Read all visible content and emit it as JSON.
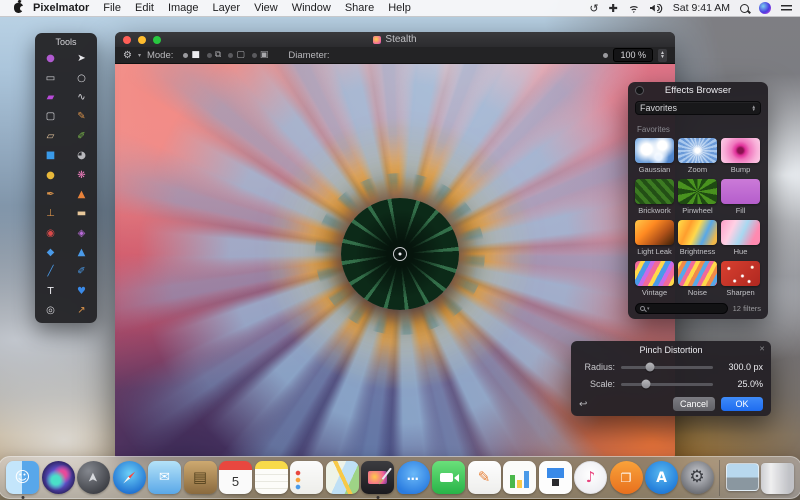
{
  "menu_bar": {
    "app_name": "Pixelmator",
    "items": [
      "File",
      "Edit",
      "Image",
      "Layer",
      "View",
      "Window",
      "Share",
      "Help"
    ],
    "status_icons": [
      "time-machine",
      "four-arrows",
      "wifi",
      "volume"
    ],
    "clock": "Sat 9:41 AM",
    "right_icons": [
      "spotlight",
      "siri",
      "notification-center"
    ],
    "time_machine_glyph": "↺",
    "four_arrows_glyph": "✚"
  },
  "tools_panel": {
    "title": "Tools",
    "tools": [
      {
        "name": "move",
        "glyph": "●",
        "color": "#b05ad0"
      },
      {
        "name": "arrange",
        "glyph": "➤",
        "color": "#e8e8ec"
      },
      {
        "name": "rectangular-selection",
        "glyph": "▭",
        "color": "#d8d8dc"
      },
      {
        "name": "elliptical-selection",
        "glyph": "○",
        "color": "#d8d8dc"
      },
      {
        "name": "magic-wand",
        "glyph": "▰",
        "color": "#b84ad8"
      },
      {
        "name": "lasso",
        "glyph": "∿",
        "color": "#d8d8dc"
      },
      {
        "name": "crop",
        "glyph": "▢",
        "color": "#d8d8dc"
      },
      {
        "name": "paint-brush",
        "glyph": "✎",
        "color": "#d8924a"
      },
      {
        "name": "eraser",
        "glyph": "▱",
        "color": "#e8c8a0"
      },
      {
        "name": "pencil",
        "glyph": "✐",
        "color": "#7ab84a"
      },
      {
        "name": "gradient",
        "glyph": "■",
        "color": "#3a9ae8"
      },
      {
        "name": "sponge",
        "glyph": "◕",
        "color": "#b8b8bc"
      },
      {
        "name": "dodge",
        "glyph": "●",
        "color": "#e8b83a"
      },
      {
        "name": "swatches",
        "glyph": "❋",
        "color": "#e87ab8"
      },
      {
        "name": "pen",
        "glyph": "✒",
        "color": "#d8924a"
      },
      {
        "name": "smudge",
        "glyph": "▲",
        "color": "#e8823a"
      },
      {
        "name": "clone-stamp",
        "glyph": "⊥",
        "color": "#d8924a"
      },
      {
        "name": "healing",
        "glyph": "▬",
        "color": "#e8c89a"
      },
      {
        "name": "red-eye",
        "glyph": "◉",
        "color": "#d84a4a"
      },
      {
        "name": "saturate",
        "glyph": "◈",
        "color": "#b86ad8"
      },
      {
        "name": "blur",
        "glyph": "◆",
        "color": "#4a9ae8"
      },
      {
        "name": "sharpen",
        "glyph": "▲",
        "color": "#4a9ae8"
      },
      {
        "name": "line",
        "glyph": "╱",
        "color": "#4a9ae8"
      },
      {
        "name": "draw-pencil",
        "glyph": "✐",
        "color": "#4a9ae8"
      },
      {
        "name": "type",
        "glyph": "T",
        "color": "#e8e8ec"
      },
      {
        "name": "shape",
        "glyph": "♥",
        "color": "#3a8ae8"
      },
      {
        "name": "zoom",
        "glyph": "◎",
        "color": "#d8d8dc"
      },
      {
        "name": "eyedropper",
        "glyph": "↗",
        "color": "#d8924a"
      }
    ]
  },
  "document_window": {
    "title": "Stealth",
    "toolbar": {
      "gear_glyph": "⚙",
      "mode_label": "Mode:",
      "modes": [
        {
          "name": "paint",
          "glyph": "■",
          "selected": true
        },
        {
          "name": "behind",
          "glyph": "⧉",
          "selected": false
        },
        {
          "name": "erase",
          "glyph": "▢",
          "selected": false
        },
        {
          "name": "refine",
          "glyph": "▣",
          "selected": false
        }
      ],
      "diameter_label": "Diameter:",
      "zoom_value": "100 %"
    }
  },
  "effects_browser": {
    "title": "Effects Browser",
    "category": "Favorites",
    "section_label": "Favorites",
    "filters": [
      {
        "key": "gaussian",
        "label": "Gaussian"
      },
      {
        "key": "zoom",
        "label": "Zoom"
      },
      {
        "key": "bump",
        "label": "Bump"
      },
      {
        "key": "brickwork",
        "label": "Brickwork"
      },
      {
        "key": "pinwheel",
        "label": "Pinwheel"
      },
      {
        "key": "fill",
        "label": "Fill"
      },
      {
        "key": "lightleak",
        "label": "Light Leak"
      },
      {
        "key": "brightness",
        "label": "Brightness"
      },
      {
        "key": "hue",
        "label": "Hue"
      },
      {
        "key": "vintage",
        "label": "Vintage"
      },
      {
        "key": "noise",
        "label": "Noise"
      },
      {
        "key": "sharpen",
        "label": "Sharpen"
      }
    ],
    "footer": "12 filters"
  },
  "pinch_panel": {
    "title": "Pinch Distortion",
    "radius_label": "Radius:",
    "radius_value": "300.0 px",
    "radius_pct": 31,
    "scale_label": "Scale:",
    "scale_value": "25.0%",
    "scale_pct": 27,
    "undo_glyph": "↩",
    "close_glyph": "✕",
    "cancel_label": "Cancel",
    "ok_label": "OK",
    "ok_color": "#2a7cf7"
  },
  "dock": {
    "apps": [
      {
        "key": "finder",
        "label": "Finder",
        "glyph": "☺",
        "running": true
      },
      {
        "key": "siri",
        "label": "Siri"
      },
      {
        "key": "launchpad",
        "label": "Launchpad",
        "glyph": "➤"
      },
      {
        "key": "safari",
        "label": "Safari"
      },
      {
        "key": "mail",
        "label": "Mail",
        "glyph": "✉"
      },
      {
        "key": "contacts",
        "label": "Contacts",
        "glyph": "▤"
      },
      {
        "key": "calendar",
        "label": "Calendar",
        "day": "5"
      },
      {
        "key": "notes",
        "label": "Notes"
      },
      {
        "key": "reminders",
        "label": "Reminders"
      },
      {
        "key": "maps",
        "label": "Maps"
      },
      {
        "key": "pixelmator",
        "label": "Pixelmator",
        "running": true
      },
      {
        "key": "messages",
        "label": "Messages",
        "glyph": "…"
      },
      {
        "key": "facetime",
        "label": "FaceTime"
      },
      {
        "key": "pages",
        "label": "Pages",
        "glyph": "✎"
      },
      {
        "key": "numbers",
        "label": "Numbers"
      },
      {
        "key": "keynote",
        "label": "Keynote"
      },
      {
        "key": "itunes",
        "label": "iTunes",
        "glyph": "♪"
      },
      {
        "key": "ibooks",
        "label": "iBooks",
        "glyph": "❐"
      },
      {
        "key": "appstore",
        "label": "App Store",
        "glyph": "A"
      },
      {
        "key": "sysprefs",
        "label": "System Preferences",
        "glyph": "⚙"
      }
    ],
    "extras": [
      {
        "key": "downloads",
        "label": "Downloads"
      },
      {
        "key": "trash",
        "label": "Trash"
      }
    ]
  }
}
